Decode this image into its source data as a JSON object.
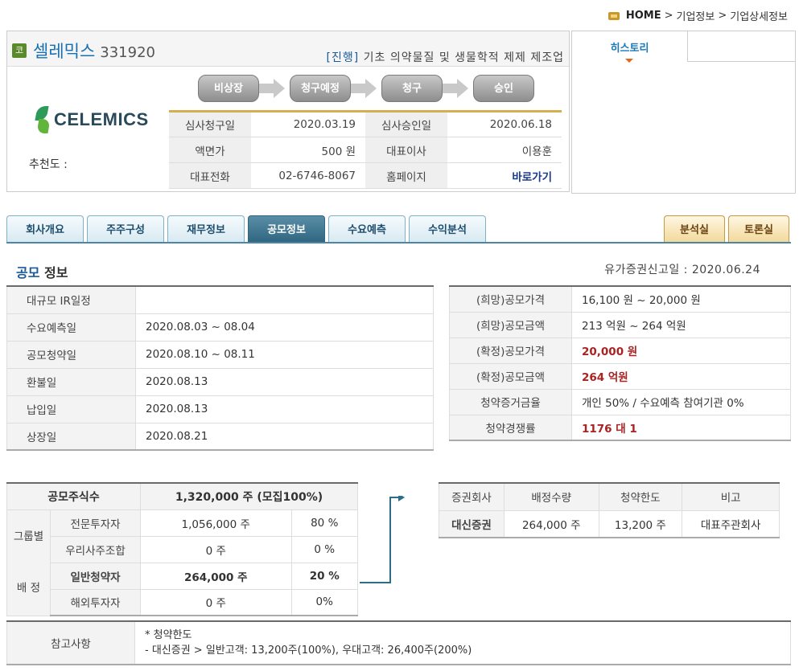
{
  "breadcrumb": {
    "home": "HOME",
    "sep": ">",
    "level1": "기업정보",
    "level2": "기업상세정보"
  },
  "company": {
    "badge": "코",
    "name": "셀레믹스",
    "code": "331920",
    "status": "[진행]",
    "description": "기초 의약물질 및 생물학적 제제 제조업",
    "logo_text": "CELEMICS",
    "recommend_label": "추천도 :",
    "steps": [
      "비상장",
      "청구예정",
      "청구",
      "승인"
    ],
    "info": {
      "request_date_label": "심사청구일",
      "request_date": "2020.03.19",
      "approve_date_label": "심사승인일",
      "approve_date": "2020.06.18",
      "par_label": "액면가",
      "par": "500 원",
      "ceo_label": "대표이사",
      "ceo": "이용훈",
      "phone_label": "대표전화",
      "phone": "02-6746-8067",
      "homepage_label": "홈페이지",
      "homepage": "바로가기"
    }
  },
  "history": {
    "tab_label": "히스토리"
  },
  "tabs": [
    "회사개요",
    "주주구성",
    "재무정보",
    "공모정보",
    "수요예측",
    "수익분석"
  ],
  "active_tab": "공모정보",
  "right_tabs": [
    "분석실",
    "토론실"
  ],
  "section": {
    "title_accent": "공모",
    "title_rest": " 정보",
    "filing": "유가증권신고일 : 2020.06.24"
  },
  "schedule": [
    {
      "label": "대규모 IR일정",
      "value": ""
    },
    {
      "label": "수요예측일",
      "value": "2020.08.03 ~ 08.04"
    },
    {
      "label": "공모청약일",
      "value": "2020.08.10 ~ 08.11"
    },
    {
      "label": "환불일",
      "value": "2020.08.13"
    },
    {
      "label": "납입일",
      "value": "2020.08.13"
    },
    {
      "label": "상장일",
      "value": "2020.08.21"
    }
  ],
  "pricing": [
    {
      "label": "(희망)공모가격",
      "value": "16,100 원 ~ 20,000 원"
    },
    {
      "label": "(희망)공모금액",
      "value": "213 억원  ~ 264 억원"
    },
    {
      "label": "(확정)공모가격",
      "value": "20,000 원"
    },
    {
      "label": "(확정)공모금액",
      "value": "264 억원"
    },
    {
      "label": "청약증거금율",
      "value": "개인 50% / 수요예측 참여기관 0%"
    },
    {
      "label": "청약경쟁률",
      "value": "1176 대 1"
    }
  ],
  "shares": {
    "total_label": "공모주식수",
    "total_value": "1,320,000 주 (모집100%)",
    "group_label_1": "그룹별",
    "group_label_2": "배 정",
    "rows": [
      {
        "label": "전문투자자",
        "shares": "1,056,000 주",
        "pct": "80 %"
      },
      {
        "label": "우리사주조합",
        "shares": "0 주",
        "pct": "0 %"
      },
      {
        "label": "일반청약자",
        "shares": "264,000 주",
        "pct": "20 %"
      },
      {
        "label": "해외투자자",
        "shares": "0 주",
        "pct": "0%"
      }
    ]
  },
  "broker": {
    "headers": [
      "증권회사",
      "배정수량",
      "청약한도",
      "비고"
    ],
    "rows": [
      {
        "name": "대신증권",
        "qty": "264,000 주",
        "limit": "13,200 주",
        "note": "대표주관회사"
      }
    ]
  },
  "notes": {
    "label": "참고사항",
    "line1": "* 청약한도",
    "line2": "- 대신증권 > 일반고객: 13,200주(100%), 우대고객: 26,400주(200%)"
  },
  "colors": {
    "accent_blue": "#1a5a9a",
    "tab_active": "#2f6580",
    "red_value": "#aa2222",
    "gold_line": "#d3b04f"
  }
}
